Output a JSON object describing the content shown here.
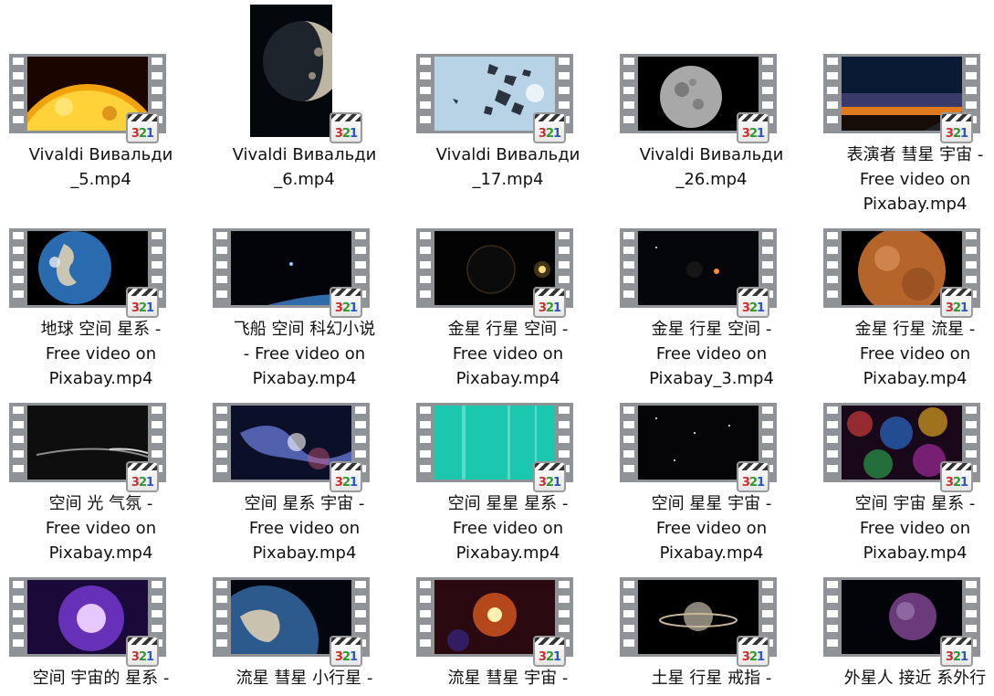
{
  "files": [
    {
      "name": "Vivaldi Вивальди\n_5.mp4",
      "thumb": "sun"
    },
    {
      "name": "Vivaldi Вивальди\n_6.mp4",
      "thumb": "moon-poster"
    },
    {
      "name": "Vivaldi Вивальди\n_17.mp4",
      "thumb": "asteroids"
    },
    {
      "name": "Vivaldi Вивальди\n_26.mp4",
      "thumb": "moon"
    },
    {
      "name": "表演者 彗星 宇宙 -\nFree video on\nPixabay.mp4",
      "thumb": "sunset"
    },
    {
      "name": "地球 空间 星系 -\nFree video on\nPixabay.mp4",
      "thumb": "earth"
    },
    {
      "name": "飞船 空间 科幻小说\n- Free video on\nPixabay.mp4",
      "thumb": "ship"
    },
    {
      "name": "金星 行星 空间 -\nFree video on\nPixabay.mp4",
      "thumb": "dark-planet"
    },
    {
      "name": "金星 行星 空间 -\nFree video on\nPixabay_3.mp4",
      "thumb": "small-planet"
    },
    {
      "name": "金星 行星 流星 -\nFree video on\nPixabay.mp4",
      "thumb": "venus"
    },
    {
      "name": "空间 光 气氛 -\nFree video on\nPixabay.mp4",
      "thumb": "light-arc"
    },
    {
      "name": "空间 星系 宇宙 -\nFree video on\nPixabay.mp4",
      "thumb": "nebula-blue"
    },
    {
      "name": "空间 星星 星系 -\nFree video on\nPixabay.mp4",
      "thumb": "teal"
    },
    {
      "name": "空间 星星 宇宙 -\nFree video on\nPixabay.mp4",
      "thumb": "starfield"
    },
    {
      "name": "空间 宇宙 星系 -\nFree video on\nPixabay.mp4",
      "thumb": "galaxy-color"
    },
    {
      "name": "空间 宇宙的 星系 -",
      "thumb": "purple-nebula"
    },
    {
      "name": "流星 彗星 小行星 -",
      "thumb": "earth-2"
    },
    {
      "name": "流星 彗星 宇宙 -",
      "thumb": "red-nebula"
    },
    {
      "name": "土星 行星 戒指 -",
      "thumb": "saturn"
    },
    {
      "name": "外星人 接近 系外行",
      "thumb": "purple-planet"
    }
  ],
  "badge_text": "321"
}
